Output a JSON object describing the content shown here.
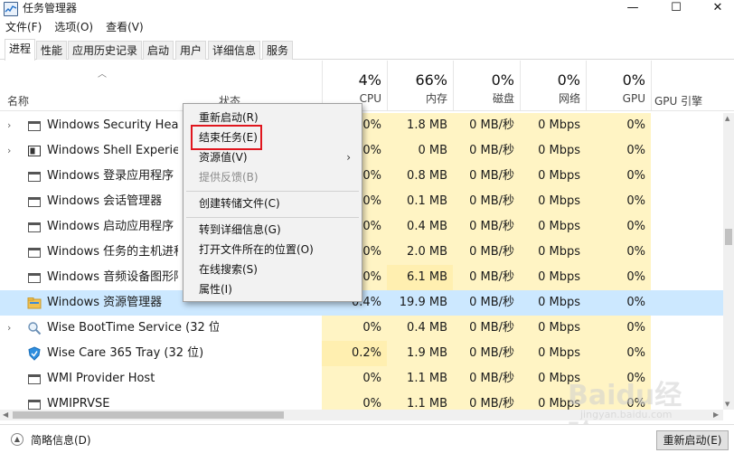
{
  "window": {
    "title": "任务管理器",
    "buttons": {
      "minimize": "—",
      "maximize": "☐",
      "close": "✕"
    }
  },
  "menu": [
    "文件(F)",
    "选项(O)",
    "查看(V)"
  ],
  "tabs": [
    "进程",
    "性能",
    "应用历史记录",
    "启动",
    "用户",
    "详细信息",
    "服务"
  ],
  "active_tab": "进程",
  "columns": {
    "name": "名称",
    "status": "状态",
    "cpu": {
      "pct": "4%",
      "label": "CPU"
    },
    "memory": {
      "pct": "66%",
      "label": "内存"
    },
    "disk": {
      "pct": "0%",
      "label": "磁盘"
    },
    "network": {
      "pct": "0%",
      "label": "网络"
    },
    "gpu": {
      "pct": "0%",
      "label": "GPU"
    },
    "gpu_engine": "GPU 引擎"
  },
  "rows": [
    {
      "name": "Windows Security Health Service",
      "cpu": "0%",
      "mem": "1.8 MB",
      "disk": "0 MB/秒",
      "net": "0 Mbps",
      "gpu": "0%",
      "icon": "app-window-icon",
      "expandable": true
    },
    {
      "name": "Windows Shell Experience Host",
      "cpu": "0%",
      "mem": "0 MB",
      "disk": "0 MB/秒",
      "net": "0 Mbps",
      "gpu": "0%",
      "icon": "shell-icon",
      "expandable": true
    },
    {
      "name": "Windows 登录应用程序",
      "cpu": "0%",
      "mem": "0.8 MB",
      "disk": "0 MB/秒",
      "net": "0 Mbps",
      "gpu": "0%",
      "icon": "app-window-icon",
      "expandable": false
    },
    {
      "name": "Windows 会话管理器",
      "cpu": "0%",
      "mem": "0.1 MB",
      "disk": "0 MB/秒",
      "net": "0 Mbps",
      "gpu": "0%",
      "icon": "app-window-icon",
      "expandable": false
    },
    {
      "name": "Windows 启动应用程序",
      "cpu": "0%",
      "mem": "0.4 MB",
      "disk": "0 MB/秒",
      "net": "0 Mbps",
      "gpu": "0%",
      "icon": "app-window-icon",
      "expandable": false
    },
    {
      "name": "Windows 任务的主机进程",
      "cpu": "0%",
      "mem": "2.0 MB",
      "disk": "0 MB/秒",
      "net": "0 Mbps",
      "gpu": "0%",
      "icon": "app-window-icon",
      "expandable": false
    },
    {
      "name": "Windows 音频设备图形隔离",
      "cpu": "0%",
      "mem": "6.1 MB",
      "disk": "0 MB/秒",
      "net": "0 Mbps",
      "gpu": "0%",
      "icon": "app-window-icon",
      "expandable": false
    },
    {
      "name": "Windows 资源管理器",
      "cpu": "0.4%",
      "mem": "19.9 MB",
      "disk": "0 MB/秒",
      "net": "0 Mbps",
      "gpu": "0%",
      "icon": "folder-icon",
      "expandable": false,
      "selected": true
    },
    {
      "name": "Wise BootTime Service (32 位)",
      "cpu": "0%",
      "mem": "0.4 MB",
      "disk": "0 MB/秒",
      "net": "0 Mbps",
      "gpu": "0%",
      "icon": "magnifier-icon",
      "expandable": true
    },
    {
      "name": "Wise Care 365 Tray (32 位)",
      "cpu": "0.2%",
      "mem": "1.9 MB",
      "disk": "0 MB/秒",
      "net": "0 Mbps",
      "gpu": "0%",
      "icon": "shield-icon",
      "expandable": false
    },
    {
      "name": "WMI Provider Host",
      "cpu": "0%",
      "mem": "1.1 MB",
      "disk": "0 MB/秒",
      "net": "0 Mbps",
      "gpu": "0%",
      "icon": "app-window-icon",
      "expandable": false
    },
    {
      "name": "WMIPRVSE",
      "cpu": "0%",
      "mem": "1.1 MB",
      "disk": "0 MB/秒",
      "net": "0 Mbps",
      "gpu": "0%",
      "icon": "app-window-icon",
      "expandable": false
    }
  ],
  "context_menu": {
    "items": [
      {
        "label": "重新启动(R)",
        "enabled": true,
        "submenu": false
      },
      {
        "label": "结束任务(E)",
        "enabled": true,
        "submenu": false,
        "highlighted": true
      },
      {
        "label": "资源值(V)",
        "enabled": true,
        "submenu": true
      },
      {
        "label": "提供反馈(B)",
        "enabled": false,
        "submenu": false
      },
      {
        "label": "创建转储文件(C)",
        "enabled": true,
        "submenu": false
      },
      {
        "label": "转到详细信息(G)",
        "enabled": true,
        "submenu": false
      },
      {
        "label": "打开文件所在的位置(O)",
        "enabled": true,
        "submenu": false
      },
      {
        "label": "在线搜索(S)",
        "enabled": true,
        "submenu": false
      },
      {
        "label": "属性(I)",
        "enabled": true,
        "submenu": false
      }
    ],
    "submenu_glyph": "›"
  },
  "footer": {
    "summary_label": "简略信息(D)",
    "restart_button": "重新启动(E)"
  },
  "watermark": {
    "brand": "Baidu经验",
    "url": "jingyan.baidu.com"
  },
  "colors": {
    "selection": "#cce8ff",
    "heat": "#fff4c4",
    "highlight_border": "#e0161e"
  }
}
